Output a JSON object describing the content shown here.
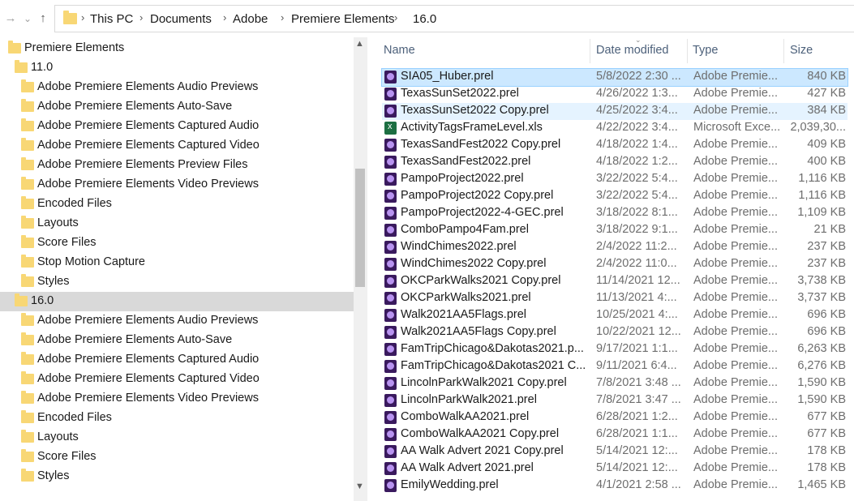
{
  "address": {
    "back_glyph": "→",
    "history_glyph": "⌄",
    "up_glyph": "↑",
    "crumbs": [
      "This PC",
      "Documents",
      "Adobe",
      "Premiere Elements",
      "16.0"
    ]
  },
  "nav": {
    "items": [
      {
        "label": "Premiere Elements"
      },
      {
        "label": "11.0"
      },
      {
        "label": "Adobe Premiere Elements Audio Previews"
      },
      {
        "label": "Adobe Premiere Elements Auto-Save"
      },
      {
        "label": "Adobe Premiere Elements Captured Audio"
      },
      {
        "label": "Adobe Premiere Elements Captured Video"
      },
      {
        "label": "Adobe Premiere Elements Preview Files"
      },
      {
        "label": "Adobe Premiere Elements Video Previews"
      },
      {
        "label": "Encoded Files"
      },
      {
        "label": "Layouts"
      },
      {
        "label": "Score Files"
      },
      {
        "label": "Stop Motion Capture"
      },
      {
        "label": "Styles"
      },
      {
        "label": "16.0"
      },
      {
        "label": "Adobe Premiere Elements Audio Previews"
      },
      {
        "label": "Adobe Premiere Elements Auto-Save"
      },
      {
        "label": "Adobe Premiere Elements Captured Audio"
      },
      {
        "label": "Adobe Premiere Elements Captured Video"
      },
      {
        "label": "Adobe Premiere Elements Video Previews"
      },
      {
        "label": "Encoded Files"
      },
      {
        "label": "Layouts"
      },
      {
        "label": "Score Files"
      },
      {
        "label": "Styles"
      }
    ],
    "selected": "16.0"
  },
  "columns": {
    "name": "Name",
    "date": "Date modified",
    "type": "Type",
    "size": "Size"
  },
  "files": [
    {
      "name": "SIA05_Huber.prel",
      "date": "5/8/2022 2:30 ...",
      "type": "Adobe Premie...",
      "size": "840 KB",
      "state": "selected"
    },
    {
      "name": "TexasSunSet2022.prel",
      "date": "4/26/2022 1:3...",
      "type": "Adobe Premie...",
      "size": "427 KB"
    },
    {
      "name": "TexasSunSet2022 Copy.prel",
      "date": "4/25/2022 3:4...",
      "type": "Adobe Premie...",
      "size": "384 KB",
      "state": "hover"
    },
    {
      "name": "ActivityTagsFrameLevel.xls",
      "date": "4/22/2022 3:4...",
      "type": "Microsoft Exce...",
      "size": "2,039,30...",
      "icon": "xls"
    },
    {
      "name": "TexasSandFest2022 Copy.prel",
      "date": "4/18/2022 1:4...",
      "type": "Adobe Premie...",
      "size": "409 KB"
    },
    {
      "name": "TexasSandFest2022.prel",
      "date": "4/18/2022 1:2...",
      "type": "Adobe Premie...",
      "size": "400 KB"
    },
    {
      "name": "PampoProject2022.prel",
      "date": "3/22/2022 5:4...",
      "type": "Adobe Premie...",
      "size": "1,116 KB"
    },
    {
      "name": "PampoProject2022 Copy.prel",
      "date": "3/22/2022 5:4...",
      "type": "Adobe Premie...",
      "size": "1,116 KB"
    },
    {
      "name": "PampoProject2022-4-GEC.prel",
      "date": "3/18/2022 8:1...",
      "type": "Adobe Premie...",
      "size": "1,109 KB"
    },
    {
      "name": "ComboPampo4Fam.prel",
      "date": "3/18/2022 9:1...",
      "type": "Adobe Premie...",
      "size": "21 KB"
    },
    {
      "name": "WindChimes2022.prel",
      "date": "2/4/2022 11:2...",
      "type": "Adobe Premie...",
      "size": "237 KB"
    },
    {
      "name": "WindChimes2022 Copy.prel",
      "date": "2/4/2022 11:0...",
      "type": "Adobe Premie...",
      "size": "237 KB"
    },
    {
      "name": "OKCParkWalks2021 Copy.prel",
      "date": "11/14/2021 12...",
      "type": "Adobe Premie...",
      "size": "3,738 KB"
    },
    {
      "name": "OKCParkWalks2021.prel",
      "date": "11/13/2021 4:...",
      "type": "Adobe Premie...",
      "size": "3,737 KB"
    },
    {
      "name": "Walk2021AA5Flags.prel",
      "date": "10/25/2021 4:...",
      "type": "Adobe Premie...",
      "size": "696 KB"
    },
    {
      "name": "Walk2021AA5Flags Copy.prel",
      "date": "10/22/2021 12...",
      "type": "Adobe Premie...",
      "size": "696 KB"
    },
    {
      "name": "FamTripChicago&Dakotas2021.p...",
      "date": "9/17/2021 1:1...",
      "type": "Adobe Premie...",
      "size": "6,263 KB"
    },
    {
      "name": "FamTripChicago&Dakotas2021 C...",
      "date": "9/11/2021 6:4...",
      "type": "Adobe Premie...",
      "size": "6,276 KB"
    },
    {
      "name": "LincolnParkWalk2021 Copy.prel",
      "date": "7/8/2021 3:48 ...",
      "type": "Adobe Premie...",
      "size": "1,590 KB"
    },
    {
      "name": "LincolnParkWalk2021.prel",
      "date": "7/8/2021 3:47 ...",
      "type": "Adobe Premie...",
      "size": "1,590 KB"
    },
    {
      "name": "ComboWalkAA2021.prel",
      "date": "6/28/2021 1:2...",
      "type": "Adobe Premie...",
      "size": "677 KB"
    },
    {
      "name": "ComboWalkAA2021 Copy.prel",
      "date": "6/28/2021 1:1...",
      "type": "Adobe Premie...",
      "size": "677 KB"
    },
    {
      "name": "AA Walk Advert 2021 Copy.prel",
      "date": "5/14/2021 12:...",
      "type": "Adobe Premie...",
      "size": "178 KB"
    },
    {
      "name": "AA Walk Advert 2021.prel",
      "date": "5/14/2021 12:...",
      "type": "Adobe Premie...",
      "size": "178 KB"
    },
    {
      "name": "EmilyWedding.prel",
      "date": "4/1/2021 2:58 ...",
      "type": "Adobe Premie...",
      "size": "1,465 KB"
    }
  ]
}
